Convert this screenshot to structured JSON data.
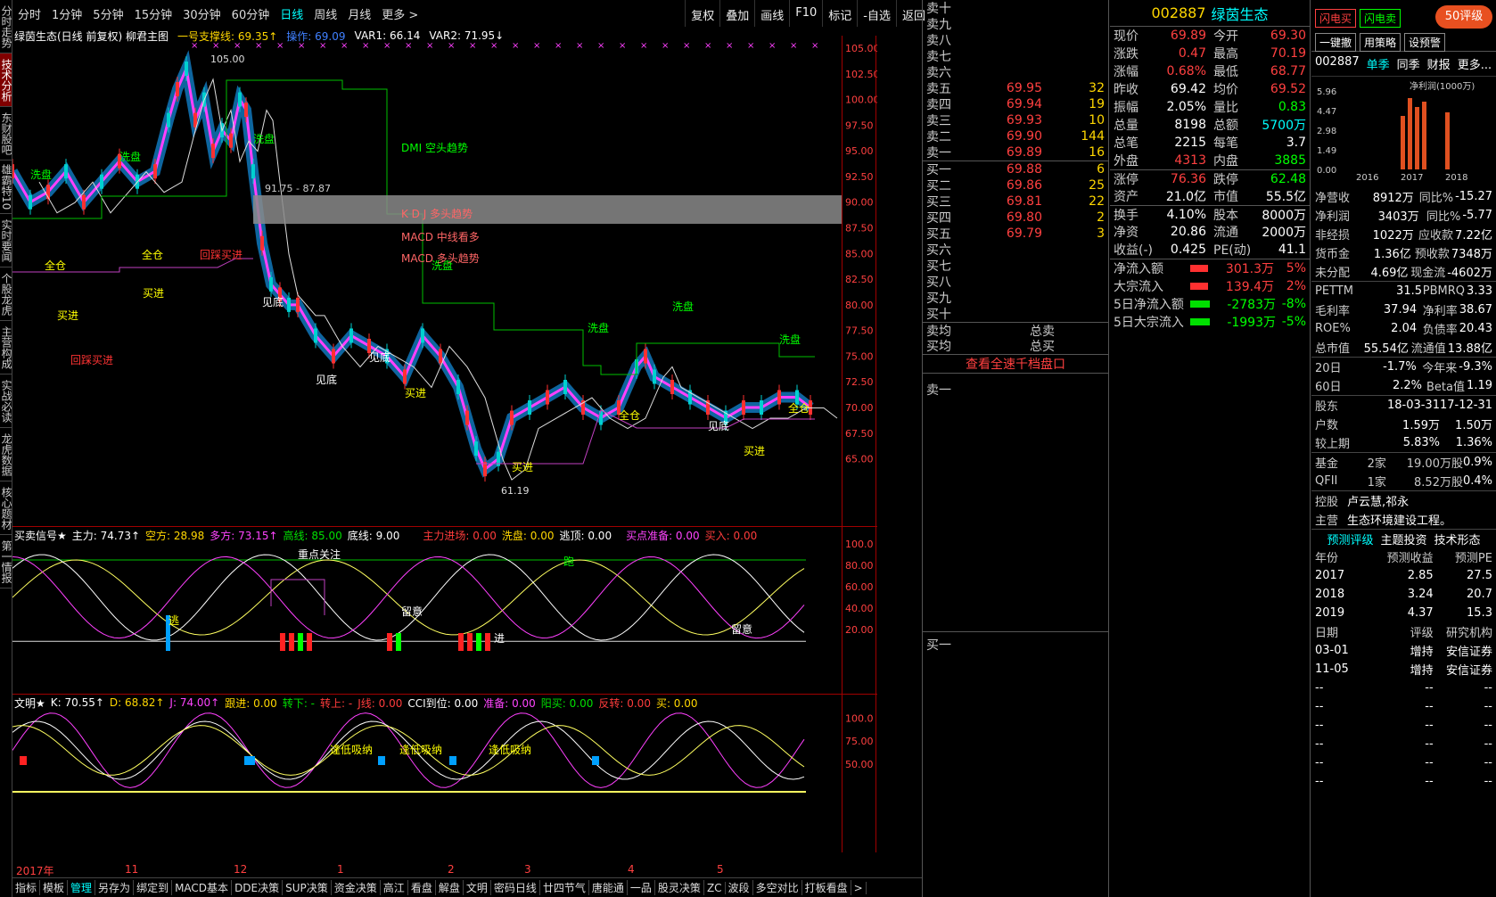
{
  "toolbar": {
    "items": [
      "分时",
      "1分钟",
      "5分钟",
      "15分钟",
      "30分钟",
      "60分钟",
      "日线",
      "周线",
      "月线",
      "更多 >"
    ],
    "right": [
      "复权",
      "叠加",
      "画线",
      "F10",
      "标记",
      "-自选",
      "返回"
    ]
  },
  "vtabs": [
    "分时走势",
    "技术分析",
    "东财股吧",
    "雄霸特10",
    "实时要闻",
    "个股龙虎",
    "主营构成",
    "实战必读",
    "龙虎数据",
    "核心题材",
    "第一情报"
  ],
  "info": {
    "title": "绿茵生态(日线 前复权) 柳君主图",
    "support": "一号支撑线: 69.35↑",
    "op": "操作: 69.09",
    "var1": "VAR1: 66.14",
    "var2": "VAR2: 71.95↓"
  },
  "yaxis_main": [
    "105.00",
    "102.50",
    "100.00",
    "97.50",
    "95.00",
    "92.50",
    "90.00",
    "87.50",
    "85.00",
    "82.50",
    "80.00",
    "77.50",
    "75.00",
    "72.50",
    "70.00",
    "67.50",
    "65.00"
  ],
  "labels_main": {
    "high": "105.00",
    "low": "61.19",
    "range": "91.75 - 87.87",
    "dmi": "DMI 空头趋势",
    "kdj": "K D J 多头趋势",
    "macd1": "MACD 中线看多",
    "macd2": "MACD 多头趋势",
    "xp": "洗盘",
    "qc": "全仓",
    "mj": "买进",
    "jd": "见底",
    "hd": "回踩买进",
    "ping": "平"
  },
  "panel2": {
    "name": "买卖信号★",
    "zl": "主力: 74.73↑",
    "kf": "空方: 28.98",
    "df": "多方: 73.15↑",
    "gx": "高线: 85.00",
    "dx": "底线: 9.00",
    "zljc": "主力进场: 0.00",
    "xp": "洗盘: 0.00",
    "td": "逃顶: 0.00",
    "mdzb": "买点准备: 0.00",
    "mr": "买入: 0.00",
    "axis": [
      "100.0",
      "80.00",
      "60.00",
      "40.00",
      "20.00"
    ],
    "zdgz": "重点关注",
    "ly": "留意",
    "jin": "进",
    "tao": "逃",
    "pao": "跑"
  },
  "panel3": {
    "name": "文明★",
    "k": "K: 70.55↑",
    "d": "D: 68.82↑",
    "j": "J: 74.00↑",
    "gj": "跟进: 0.00",
    "zx": "转下: -",
    "zs": "转上: -",
    "jx": "J线: 0.00",
    "cci": "CCI到位: 0.00",
    "zb": "准备: 0.00",
    "yt": "阳买: 0.00",
    "fz": "反转: 0.00",
    "mai": "买: 0.00",
    "axis": [
      "100.0",
      "75.00",
      "50.00"
    ],
    "fdxn": "逢低吸纳"
  },
  "months": [
    "2017年",
    "11",
    "12",
    "1",
    "2",
    "3",
    "4",
    "5"
  ],
  "bottombar": [
    "指标",
    "模板",
    "管理",
    "另存为",
    "绑定到",
    "MACD基本",
    "DDE决策",
    "SUP决策",
    "资金决策",
    "高江",
    "看盘",
    "解盘",
    "文明",
    "密码日线",
    "廿四节气",
    "唐能通",
    "一品",
    "股灵决策",
    "ZC",
    "波段",
    "多空对比",
    "打板看盘",
    ">"
  ],
  "orderbook": {
    "sells": [
      [
        "卖十",
        "",
        ""
      ],
      [
        "卖九",
        "",
        ""
      ],
      [
        "卖八",
        "",
        ""
      ],
      [
        "卖七",
        "",
        ""
      ],
      [
        "卖六",
        "",
        ""
      ],
      [
        "卖五",
        "69.95",
        "32"
      ],
      [
        "卖四",
        "69.94",
        "19"
      ],
      [
        "卖三",
        "69.93",
        "10"
      ],
      [
        "卖二",
        "69.90",
        "144"
      ],
      [
        "卖一",
        "69.89",
        "16"
      ]
    ],
    "buys": [
      [
        "买一",
        "69.88",
        "6"
      ],
      [
        "买二",
        "69.86",
        "25"
      ],
      [
        "买三",
        "69.81",
        "22"
      ],
      [
        "买四",
        "69.80",
        "2"
      ],
      [
        "买五",
        "69.79",
        "3"
      ],
      [
        "买六",
        "",
        ""
      ],
      [
        "买七",
        "",
        ""
      ],
      [
        "买八",
        "",
        ""
      ],
      [
        "买九",
        "",
        ""
      ],
      [
        "买十",
        "",
        ""
      ]
    ],
    "avg_sell": "卖均",
    "avg_buy": "买均",
    "total_sell": "总卖",
    "total_buy": "总买",
    "link": "查看全速千档盘口",
    "s1": "卖一",
    "b1": "买一"
  },
  "quote": {
    "code": "002887",
    "name": "绿茵生态",
    "rows": [
      [
        "现价",
        "69.89",
        "今开",
        "69.30"
      ],
      [
        "涨跌",
        "0.47",
        "最高",
        "70.19"
      ],
      [
        "涨幅",
        "0.68%",
        "最低",
        "68.77"
      ],
      [
        "昨收",
        "69.42",
        "均价",
        "69.52"
      ],
      [
        "振幅",
        "2.05%",
        "量比",
        "0.83"
      ],
      [
        "总量",
        "8198",
        "总额",
        "5700万"
      ],
      [
        "总笔",
        "2215",
        "每笔",
        "3.7"
      ],
      [
        "外盘",
        "4313",
        "内盘",
        "3885"
      ],
      [
        "涨停",
        "76.36",
        "跌停",
        "62.48"
      ],
      [
        "资产",
        "21.0亿",
        "市值",
        "55.5亿"
      ],
      [
        "换手",
        "4.10%",
        "股本",
        "8000万"
      ],
      [
        "净资",
        "20.86",
        "流通",
        "2000万"
      ],
      [
        "收益(-)",
        "0.425",
        "PE(动)",
        "41.1"
      ]
    ],
    "flow": [
      [
        "净流入额",
        "301.3万",
        "5%"
      ],
      [
        "大宗流入",
        "139.4万",
        "2%"
      ],
      [
        "5日净流入额",
        "-2783万",
        "-8%"
      ],
      [
        "5日大宗流入",
        "-1993万",
        "-5%"
      ]
    ]
  },
  "f10": {
    "btns": [
      "闪电买",
      "闪电卖",
      "一键撤",
      "用策略",
      "设预警"
    ],
    "logo": "50评级",
    "code": "002887",
    "tabs": [
      "单季",
      "同季",
      "财报",
      "更多..."
    ],
    "chart_title": "净利润(1000万)",
    "chart_y": [
      "5.96",
      "4.47",
      "2.98",
      "1.49",
      "0.00"
    ],
    "chart_x": [
      "2016",
      "2017",
      "2018"
    ],
    "rows1": [
      [
        "净营收",
        "8912万",
        "同比%",
        "-15.27"
      ],
      [
        "净利润",
        "3403万",
        "同比%",
        "-5.77"
      ],
      [
        "非经损",
        "1022万",
        "应收款",
        "7.22亿"
      ],
      [
        "货币金",
        "1.36亿",
        "预收款",
        "7348万"
      ],
      [
        "未分配",
        "4.69亿",
        "现金流",
        "-4602万"
      ]
    ],
    "rows2": [
      [
        "PETTM",
        "31.5",
        "PBMRQ",
        "3.33"
      ],
      [
        "毛利率",
        "37.94",
        "净利率",
        "38.67"
      ],
      [
        "ROE%",
        "2.04",
        "负债率",
        "20.43"
      ],
      [
        "总市值",
        "55.54亿",
        "流通值",
        "13.88亿"
      ]
    ],
    "rows3": [
      [
        "20日",
        "-1.7%",
        "今年来",
        "-9.3%"
      ],
      [
        "60日",
        "2.2%",
        "Beta值",
        "1.19"
      ]
    ],
    "holders": [
      [
        "股东",
        "18-03-31",
        "17-12-31"
      ],
      [
        "户数",
        "1.59万",
        "1.50万"
      ],
      [
        "较上期",
        "5.83%",
        "1.36%"
      ]
    ],
    "funds": [
      [
        "基金",
        "2家",
        "19.00万股",
        "0.9%"
      ],
      [
        "QFII",
        "1家",
        "8.52万股",
        "0.4%"
      ]
    ],
    "ctrl": [
      "控股",
      "卢云慧,祁永"
    ],
    "biz": [
      "主营",
      "生态环境建设工程。"
    ],
    "tabs2": [
      "预测评级",
      "主题投资",
      "技术形态"
    ],
    "fc_head": [
      "年份",
      "预测收益",
      "预测PE"
    ],
    "fc": [
      [
        "2017",
        "2.85",
        "27.5"
      ],
      [
        "2018",
        "3.24",
        "20.7"
      ],
      [
        "2019",
        "4.37",
        "15.3"
      ]
    ],
    "rate_head": [
      "日期",
      "评级",
      "研究机构"
    ],
    "rates": [
      [
        "03-01",
        "增持",
        "安信证券"
      ],
      [
        "11-05",
        "增持",
        "安信证券"
      ],
      [
        "--",
        "--",
        "--"
      ],
      [
        "--",
        "--",
        "--"
      ],
      [
        "--",
        "--",
        "--"
      ],
      [
        "--",
        "--",
        "--"
      ],
      [
        "--",
        "--",
        "--"
      ],
      [
        "--",
        "--",
        "--"
      ]
    ]
  }
}
